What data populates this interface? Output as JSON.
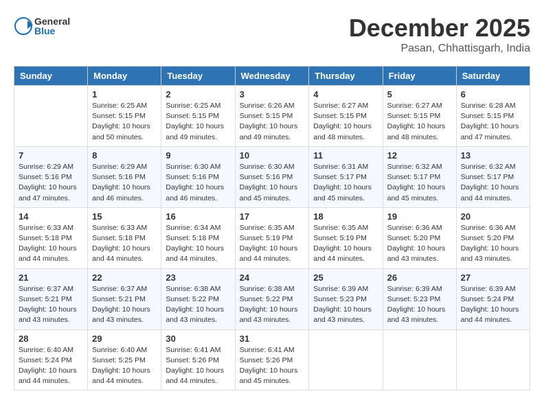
{
  "logo": {
    "general": "General",
    "blue": "Blue"
  },
  "title": {
    "month": "December 2025",
    "location": "Pasan, Chhattisgarh, India"
  },
  "headers": [
    "Sunday",
    "Monday",
    "Tuesday",
    "Wednesday",
    "Thursday",
    "Friday",
    "Saturday"
  ],
  "weeks": [
    [
      {
        "day": "",
        "text": ""
      },
      {
        "day": "1",
        "text": "Sunrise: 6:25 AM\nSunset: 5:15 PM\nDaylight: 10 hours\nand 50 minutes."
      },
      {
        "day": "2",
        "text": "Sunrise: 6:25 AM\nSunset: 5:15 PM\nDaylight: 10 hours\nand 49 minutes."
      },
      {
        "day": "3",
        "text": "Sunrise: 6:26 AM\nSunset: 5:15 PM\nDaylight: 10 hours\nand 49 minutes."
      },
      {
        "day": "4",
        "text": "Sunrise: 6:27 AM\nSunset: 5:15 PM\nDaylight: 10 hours\nand 48 minutes."
      },
      {
        "day": "5",
        "text": "Sunrise: 6:27 AM\nSunset: 5:15 PM\nDaylight: 10 hours\nand 48 minutes."
      },
      {
        "day": "6",
        "text": "Sunrise: 6:28 AM\nSunset: 5:15 PM\nDaylight: 10 hours\nand 47 minutes."
      }
    ],
    [
      {
        "day": "7",
        "text": "Sunrise: 6:29 AM\nSunset: 5:16 PM\nDaylight: 10 hours\nand 47 minutes."
      },
      {
        "day": "8",
        "text": "Sunrise: 6:29 AM\nSunset: 5:16 PM\nDaylight: 10 hours\nand 46 minutes."
      },
      {
        "day": "9",
        "text": "Sunrise: 6:30 AM\nSunset: 5:16 PM\nDaylight: 10 hours\nand 46 minutes."
      },
      {
        "day": "10",
        "text": "Sunrise: 6:30 AM\nSunset: 5:16 PM\nDaylight: 10 hours\nand 45 minutes."
      },
      {
        "day": "11",
        "text": "Sunrise: 6:31 AM\nSunset: 5:17 PM\nDaylight: 10 hours\nand 45 minutes."
      },
      {
        "day": "12",
        "text": "Sunrise: 6:32 AM\nSunset: 5:17 PM\nDaylight: 10 hours\nand 45 minutes."
      },
      {
        "day": "13",
        "text": "Sunrise: 6:32 AM\nSunset: 5:17 PM\nDaylight: 10 hours\nand 44 minutes."
      }
    ],
    [
      {
        "day": "14",
        "text": "Sunrise: 6:33 AM\nSunset: 5:18 PM\nDaylight: 10 hours\nand 44 minutes."
      },
      {
        "day": "15",
        "text": "Sunrise: 6:33 AM\nSunset: 5:18 PM\nDaylight: 10 hours\nand 44 minutes."
      },
      {
        "day": "16",
        "text": "Sunrise: 6:34 AM\nSunset: 5:18 PM\nDaylight: 10 hours\nand 44 minutes."
      },
      {
        "day": "17",
        "text": "Sunrise: 6:35 AM\nSunset: 5:19 PM\nDaylight: 10 hours\nand 44 minutes."
      },
      {
        "day": "18",
        "text": "Sunrise: 6:35 AM\nSunset: 5:19 PM\nDaylight: 10 hours\nand 44 minutes."
      },
      {
        "day": "19",
        "text": "Sunrise: 6:36 AM\nSunset: 5:20 PM\nDaylight: 10 hours\nand 43 minutes."
      },
      {
        "day": "20",
        "text": "Sunrise: 6:36 AM\nSunset: 5:20 PM\nDaylight: 10 hours\nand 43 minutes."
      }
    ],
    [
      {
        "day": "21",
        "text": "Sunrise: 6:37 AM\nSunset: 5:21 PM\nDaylight: 10 hours\nand 43 minutes."
      },
      {
        "day": "22",
        "text": "Sunrise: 6:37 AM\nSunset: 5:21 PM\nDaylight: 10 hours\nand 43 minutes."
      },
      {
        "day": "23",
        "text": "Sunrise: 6:38 AM\nSunset: 5:22 PM\nDaylight: 10 hours\nand 43 minutes."
      },
      {
        "day": "24",
        "text": "Sunrise: 6:38 AM\nSunset: 5:22 PM\nDaylight: 10 hours\nand 43 minutes."
      },
      {
        "day": "25",
        "text": "Sunrise: 6:39 AM\nSunset: 5:23 PM\nDaylight: 10 hours\nand 43 minutes."
      },
      {
        "day": "26",
        "text": "Sunrise: 6:39 AM\nSunset: 5:23 PM\nDaylight: 10 hours\nand 43 minutes."
      },
      {
        "day": "27",
        "text": "Sunrise: 6:39 AM\nSunset: 5:24 PM\nDaylight: 10 hours\nand 44 minutes."
      }
    ],
    [
      {
        "day": "28",
        "text": "Sunrise: 6:40 AM\nSunset: 5:24 PM\nDaylight: 10 hours\nand 44 minutes."
      },
      {
        "day": "29",
        "text": "Sunrise: 6:40 AM\nSunset: 5:25 PM\nDaylight: 10 hours\nand 44 minutes."
      },
      {
        "day": "30",
        "text": "Sunrise: 6:41 AM\nSunset: 5:26 PM\nDaylight: 10 hours\nand 44 minutes."
      },
      {
        "day": "31",
        "text": "Sunrise: 6:41 AM\nSunset: 5:26 PM\nDaylight: 10 hours\nand 45 minutes."
      },
      {
        "day": "",
        "text": ""
      },
      {
        "day": "",
        "text": ""
      },
      {
        "day": "",
        "text": ""
      }
    ]
  ]
}
